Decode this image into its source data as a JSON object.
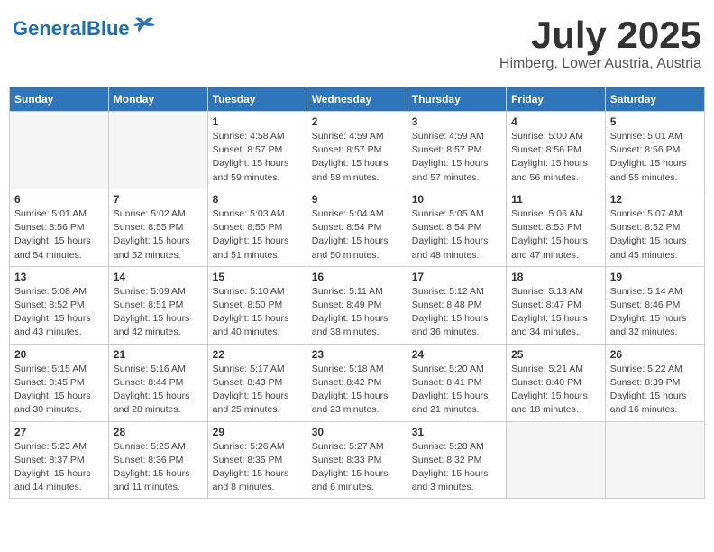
{
  "logo": {
    "name_part1": "General",
    "name_part2": "Blue"
  },
  "title": "July 2025",
  "subtitle": "Himberg, Lower Austria, Austria",
  "weekdays": [
    "Sunday",
    "Monday",
    "Tuesday",
    "Wednesday",
    "Thursday",
    "Friday",
    "Saturday"
  ],
  "weeks": [
    [
      {
        "day": "",
        "empty": true
      },
      {
        "day": "",
        "empty": true
      },
      {
        "day": "1",
        "sunrise": "Sunrise: 4:58 AM",
        "sunset": "Sunset: 8:57 PM",
        "daylight": "Daylight: 15 hours and 59 minutes."
      },
      {
        "day": "2",
        "sunrise": "Sunrise: 4:59 AM",
        "sunset": "Sunset: 8:57 PM",
        "daylight": "Daylight: 15 hours and 58 minutes."
      },
      {
        "day": "3",
        "sunrise": "Sunrise: 4:59 AM",
        "sunset": "Sunset: 8:57 PM",
        "daylight": "Daylight: 15 hours and 57 minutes."
      },
      {
        "day": "4",
        "sunrise": "Sunrise: 5:00 AM",
        "sunset": "Sunset: 8:56 PM",
        "daylight": "Daylight: 15 hours and 56 minutes."
      },
      {
        "day": "5",
        "sunrise": "Sunrise: 5:01 AM",
        "sunset": "Sunset: 8:56 PM",
        "daylight": "Daylight: 15 hours and 55 minutes."
      }
    ],
    [
      {
        "day": "6",
        "sunrise": "Sunrise: 5:01 AM",
        "sunset": "Sunset: 8:56 PM",
        "daylight": "Daylight: 15 hours and 54 minutes."
      },
      {
        "day": "7",
        "sunrise": "Sunrise: 5:02 AM",
        "sunset": "Sunset: 8:55 PM",
        "daylight": "Daylight: 15 hours and 52 minutes."
      },
      {
        "day": "8",
        "sunrise": "Sunrise: 5:03 AM",
        "sunset": "Sunset: 8:55 PM",
        "daylight": "Daylight: 15 hours and 51 minutes."
      },
      {
        "day": "9",
        "sunrise": "Sunrise: 5:04 AM",
        "sunset": "Sunset: 8:54 PM",
        "daylight": "Daylight: 15 hours and 50 minutes."
      },
      {
        "day": "10",
        "sunrise": "Sunrise: 5:05 AM",
        "sunset": "Sunset: 8:54 PM",
        "daylight": "Daylight: 15 hours and 48 minutes."
      },
      {
        "day": "11",
        "sunrise": "Sunrise: 5:06 AM",
        "sunset": "Sunset: 8:53 PM",
        "daylight": "Daylight: 15 hours and 47 minutes."
      },
      {
        "day": "12",
        "sunrise": "Sunrise: 5:07 AM",
        "sunset": "Sunset: 8:52 PM",
        "daylight": "Daylight: 15 hours and 45 minutes."
      }
    ],
    [
      {
        "day": "13",
        "sunrise": "Sunrise: 5:08 AM",
        "sunset": "Sunset: 8:52 PM",
        "daylight": "Daylight: 15 hours and 43 minutes."
      },
      {
        "day": "14",
        "sunrise": "Sunrise: 5:09 AM",
        "sunset": "Sunset: 8:51 PM",
        "daylight": "Daylight: 15 hours and 42 minutes."
      },
      {
        "day": "15",
        "sunrise": "Sunrise: 5:10 AM",
        "sunset": "Sunset: 8:50 PM",
        "daylight": "Daylight: 15 hours and 40 minutes."
      },
      {
        "day": "16",
        "sunrise": "Sunrise: 5:11 AM",
        "sunset": "Sunset: 8:49 PM",
        "daylight": "Daylight: 15 hours and 38 minutes."
      },
      {
        "day": "17",
        "sunrise": "Sunrise: 5:12 AM",
        "sunset": "Sunset: 8:48 PM",
        "daylight": "Daylight: 15 hours and 36 minutes."
      },
      {
        "day": "18",
        "sunrise": "Sunrise: 5:13 AM",
        "sunset": "Sunset: 8:47 PM",
        "daylight": "Daylight: 15 hours and 34 minutes."
      },
      {
        "day": "19",
        "sunrise": "Sunrise: 5:14 AM",
        "sunset": "Sunset: 8:46 PM",
        "daylight": "Daylight: 15 hours and 32 minutes."
      }
    ],
    [
      {
        "day": "20",
        "sunrise": "Sunrise: 5:15 AM",
        "sunset": "Sunset: 8:45 PM",
        "daylight": "Daylight: 15 hours and 30 minutes."
      },
      {
        "day": "21",
        "sunrise": "Sunrise: 5:16 AM",
        "sunset": "Sunset: 8:44 PM",
        "daylight": "Daylight: 15 hours and 28 minutes."
      },
      {
        "day": "22",
        "sunrise": "Sunrise: 5:17 AM",
        "sunset": "Sunset: 8:43 PM",
        "daylight": "Daylight: 15 hours and 25 minutes."
      },
      {
        "day": "23",
        "sunrise": "Sunrise: 5:18 AM",
        "sunset": "Sunset: 8:42 PM",
        "daylight": "Daylight: 15 hours and 23 minutes."
      },
      {
        "day": "24",
        "sunrise": "Sunrise: 5:20 AM",
        "sunset": "Sunset: 8:41 PM",
        "daylight": "Daylight: 15 hours and 21 minutes."
      },
      {
        "day": "25",
        "sunrise": "Sunrise: 5:21 AM",
        "sunset": "Sunset: 8:40 PM",
        "daylight": "Daylight: 15 hours and 18 minutes."
      },
      {
        "day": "26",
        "sunrise": "Sunrise: 5:22 AM",
        "sunset": "Sunset: 8:39 PM",
        "daylight": "Daylight: 15 hours and 16 minutes."
      }
    ],
    [
      {
        "day": "27",
        "sunrise": "Sunrise: 5:23 AM",
        "sunset": "Sunset: 8:37 PM",
        "daylight": "Daylight: 15 hours and 14 minutes."
      },
      {
        "day": "28",
        "sunrise": "Sunrise: 5:25 AM",
        "sunset": "Sunset: 8:36 PM",
        "daylight": "Daylight: 15 hours and 11 minutes."
      },
      {
        "day": "29",
        "sunrise": "Sunrise: 5:26 AM",
        "sunset": "Sunset: 8:35 PM",
        "daylight": "Daylight: 15 hours and 8 minutes."
      },
      {
        "day": "30",
        "sunrise": "Sunrise: 5:27 AM",
        "sunset": "Sunset: 8:33 PM",
        "daylight": "Daylight: 15 hours and 6 minutes."
      },
      {
        "day": "31",
        "sunrise": "Sunrise: 5:28 AM",
        "sunset": "Sunset: 8:32 PM",
        "daylight": "Daylight: 15 hours and 3 minutes."
      },
      {
        "day": "",
        "empty": true
      },
      {
        "day": "",
        "empty": true
      }
    ]
  ]
}
